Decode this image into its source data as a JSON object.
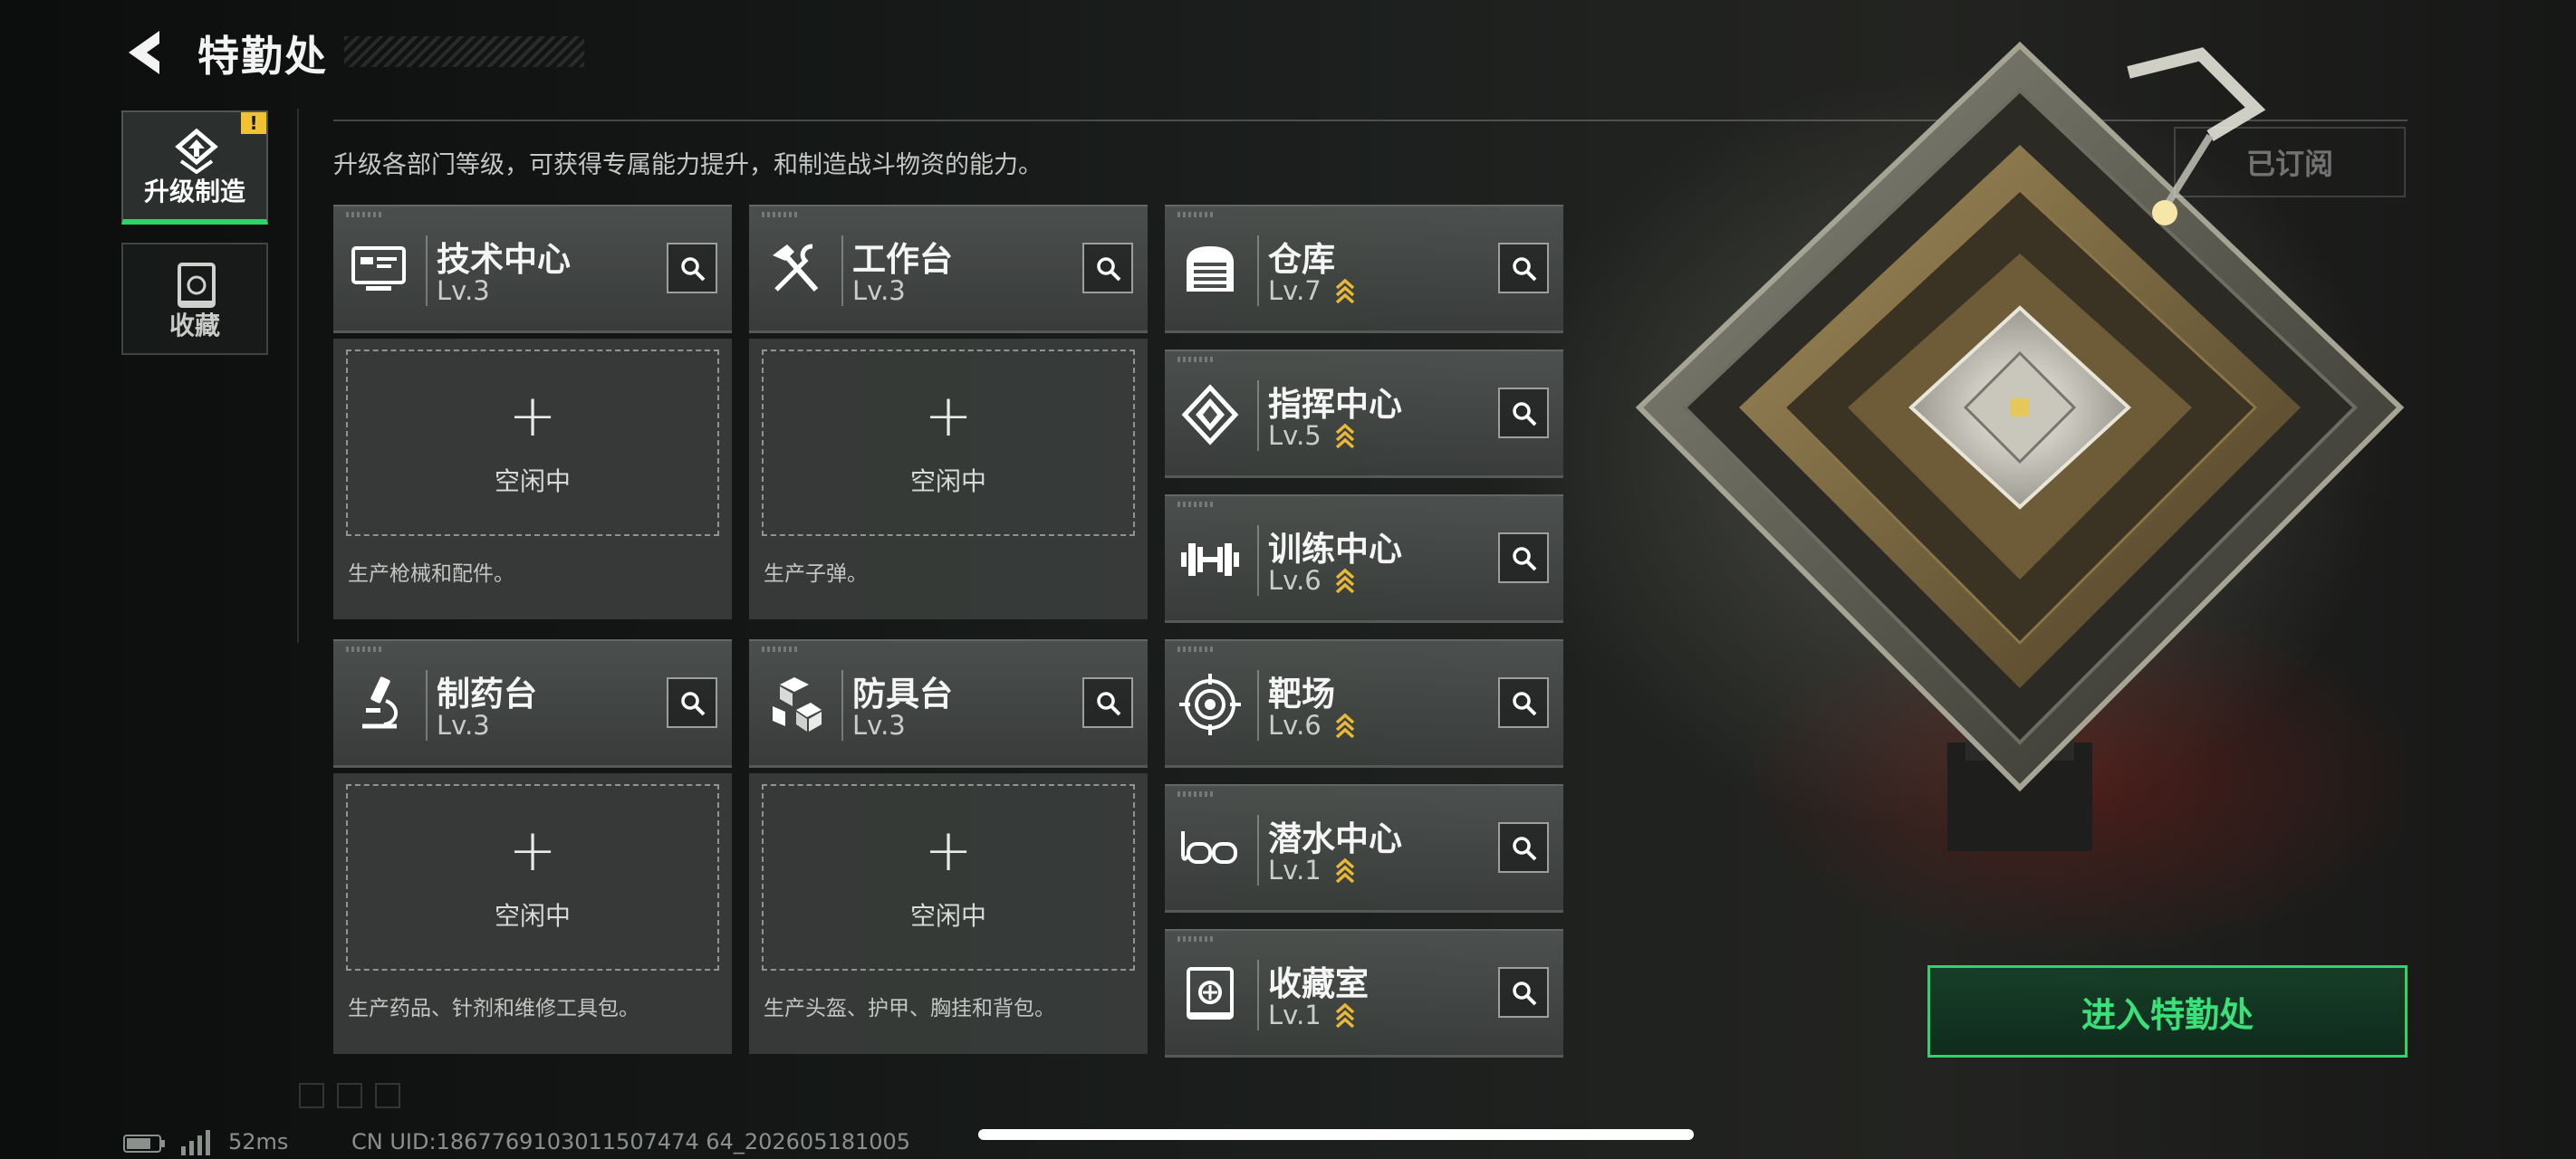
{
  "header": {
    "title": "特勤处"
  },
  "sidebar": {
    "items": [
      {
        "label": "升级制造",
        "active": true,
        "badge": "!"
      },
      {
        "label": "收藏",
        "active": false
      }
    ]
  },
  "description": "升级各部门等级，可获得专属能力提升，和制造战斗物资的能力。",
  "facilities": [
    {
      "name": "技术中心",
      "level": "Lv.3",
      "icon": "monitor-icon"
    },
    {
      "name": "工作台",
      "level": "Lv.3",
      "icon": "tools-icon"
    },
    {
      "name": "制药台",
      "level": "Lv.3",
      "icon": "microscope-icon"
    },
    {
      "name": "防具台",
      "level": "Lv.3",
      "icon": "cubes-icon"
    },
    {
      "name": "仓库",
      "level": "Lv.7",
      "icon": "warehouse-icon",
      "upgrade_available": true
    },
    {
      "name": "指挥中心",
      "level": "Lv.5",
      "icon": "chip-icon",
      "upgrade_available": true
    },
    {
      "name": "训练中心",
      "level": "Lv.6",
      "icon": "dumbbell-icon",
      "upgrade_available": true
    },
    {
      "name": "靶场",
      "level": "Lv.6",
      "icon": "target-icon",
      "upgrade_available": true
    },
    {
      "name": "潜水中心",
      "level": "Lv.1",
      "icon": "goggles-icon",
      "upgrade_available": true
    },
    {
      "name": "收藏室",
      "level": "Lv.1",
      "icon": "vault-icon",
      "upgrade_available": true
    }
  ],
  "slots": [
    {
      "plus": "+",
      "status": "空闲中",
      "description": "生产枪械和配件。"
    },
    {
      "plus": "+",
      "status": "空闲中",
      "description": "生产子弹。"
    },
    {
      "plus": "+",
      "status": "空闲中",
      "description": "生产药品、针剂和维修工具包。"
    },
    {
      "plus": "+",
      "status": "空闲中",
      "description": "生产头盔、护甲、胸挂和背包。"
    }
  ],
  "subscribed_label": "已订阅",
  "enter_button": "进入特勤处",
  "status_bar": {
    "ping": "52ms",
    "uid": "CN UID:1867769103011507474 64_202605181005"
  },
  "colors": {
    "accent": "#2fd56b",
    "upgrade_chevron": "#e8b838",
    "alert": "#f1c232",
    "card": "#4a4e4c"
  }
}
